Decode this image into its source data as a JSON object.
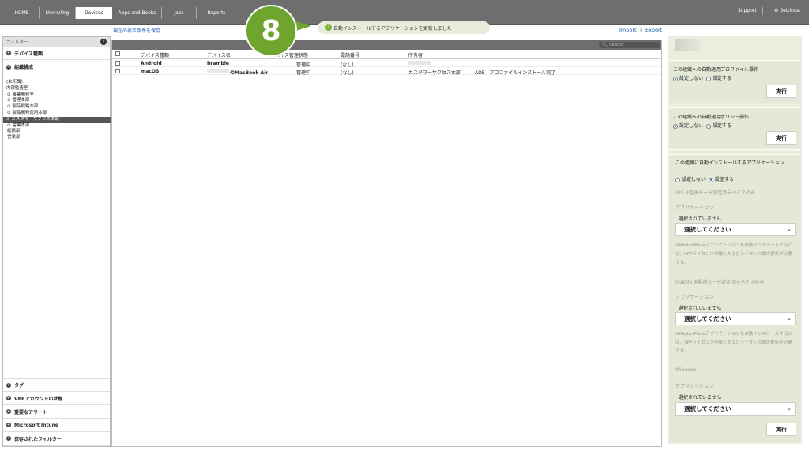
{
  "topbar": {
    "nav": [
      "HOME",
      "Users/Org",
      "Devices",
      "Apps and Books",
      "Jobs",
      "Reports"
    ],
    "support": "Support",
    "settings": "Settings"
  },
  "toolbar": {
    "save_filter": "現在の表示条件を保存",
    "import": "Import",
    "export": "Export",
    "search_placeholder": "Search"
  },
  "toast": {
    "message": "自動インストールするアプリケーションを更新しました",
    "step_number": "8"
  },
  "sidebar": {
    "filter_label": "フィルター",
    "sections_top": [
      "デバイス種類",
      "組織構成"
    ],
    "tree": [
      "(未所属)",
      "内部監査室",
      "事業開発室",
      "管理本部",
      "製品戦略本部",
      "製品開発運用本部",
      "カスタマーサクセス本部",
      "営業本部",
      "総務部",
      "営業部"
    ],
    "sections_bottom": [
      "タグ",
      "VPPアカウントの状態",
      "重要なアラート",
      "Microsoft Intune",
      "保存されたフィルター"
    ]
  },
  "table": {
    "headers": [
      "デバイス種類",
      "デバイス名",
      "デバイス管理状態",
      "電話番号",
      "所有者"
    ],
    "rows": [
      {
        "type": "Android",
        "name": "bramble",
        "status": "管理中",
        "phone": "(なし)",
        "owner": "",
        "note": ""
      },
      {
        "type": "macOS",
        "name": "のMacBook Air",
        "status": "管理中",
        "phone": "(なし)",
        "owner": "カスタマーサクセス本部",
        "note": "ADE : プロファイルインストール完了"
      }
    ]
  },
  "right_panel": {
    "profile": {
      "title": "この組織への自動適用プロファイル操作",
      "opt_off": "設定しない",
      "opt_on": "設定する",
      "button": "実行"
    },
    "policy": {
      "title": "この組織への自動適用ポリシー操作",
      "opt_off": "設定しない",
      "opt_on": "設定する",
      "button": "実行"
    },
    "apps": {
      "title": "この組織に自動インストールするアプリケーション",
      "opt_off": "設定しない",
      "opt_on": "設定する",
      "ios_label": "iOS ※監視モード設定済デバイスのみ",
      "app_label": "アプリケーション",
      "none_selected": "選択されていません",
      "select_placeholder": "選択してください",
      "note": "※MarketPlaceアプリケーションを自動インストールするには、VPPライセンスの購入およびライセンス数の更新が必要です。",
      "macos_label": "macOS ※監視モード設定済デバイスのみ",
      "windows_label": "Windows",
      "button": "実行"
    }
  }
}
